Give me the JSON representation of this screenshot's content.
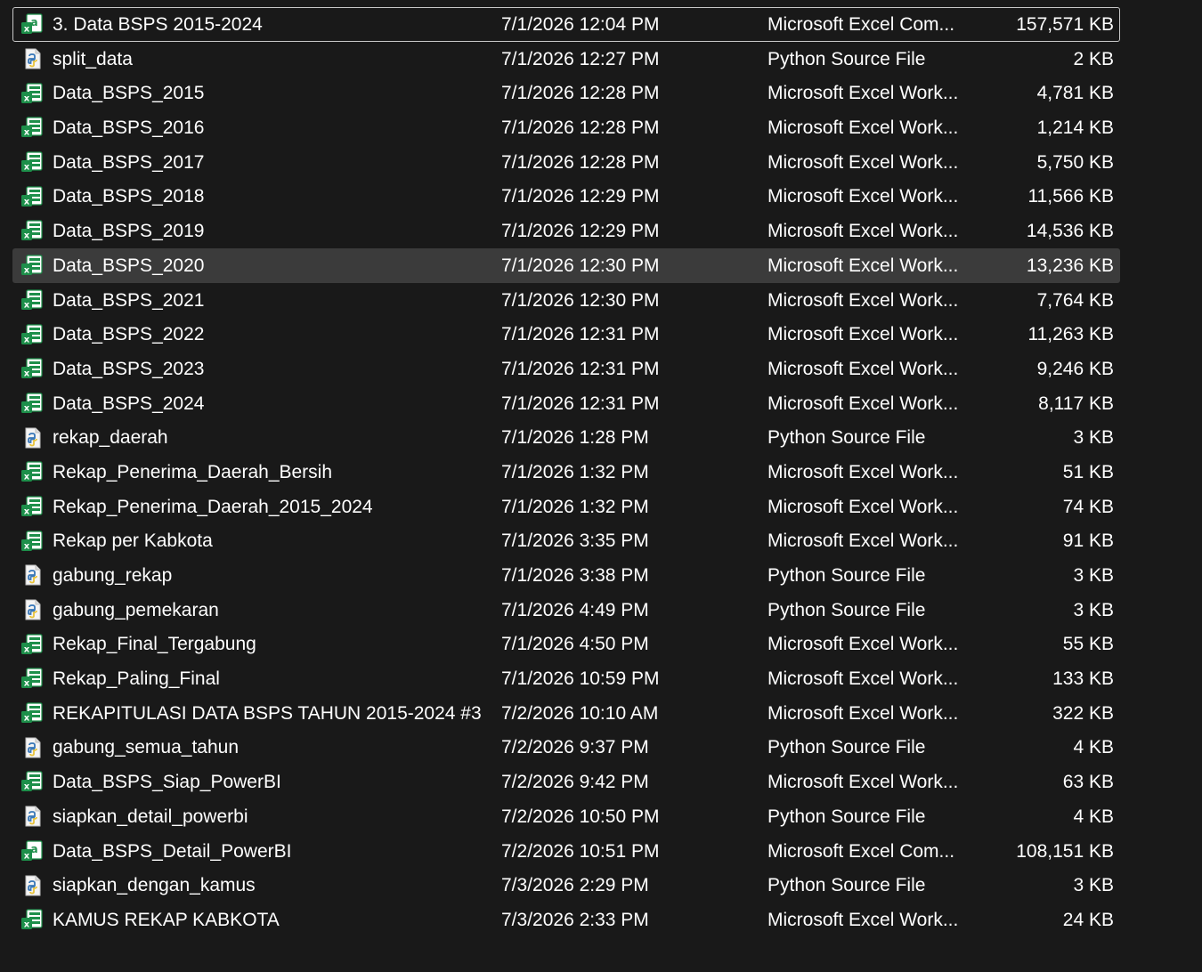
{
  "colors": {
    "background": "#191919",
    "text": "#ffffff",
    "selected_row": "#3b3b3b",
    "focus_border": "#c8c8c8",
    "excel_green": "#1d8f4a",
    "python_blue": "#3a78b8"
  },
  "files": [
    {
      "name": "3. Data BSPS 2015-2024",
      "date": "7/1/2026 12:04 PM",
      "type": "Microsoft Excel Com...",
      "size": "157,571 KB",
      "icon": "excel-csv-icon",
      "state": "focused"
    },
    {
      "name": "split_data",
      "date": "7/1/2026 12:27 PM",
      "type": "Python Source File",
      "size": "2 KB",
      "icon": "python-file-icon",
      "state": ""
    },
    {
      "name": "Data_BSPS_2015",
      "date": "7/1/2026 12:28 PM",
      "type": "Microsoft Excel Work...",
      "size": "4,781 KB",
      "icon": "excel-workbook-icon",
      "state": ""
    },
    {
      "name": "Data_BSPS_2016",
      "date": "7/1/2026 12:28 PM",
      "type": "Microsoft Excel Work...",
      "size": "1,214 KB",
      "icon": "excel-workbook-icon",
      "state": ""
    },
    {
      "name": "Data_BSPS_2017",
      "date": "7/1/2026 12:28 PM",
      "type": "Microsoft Excel Work...",
      "size": "5,750 KB",
      "icon": "excel-workbook-icon",
      "state": ""
    },
    {
      "name": "Data_BSPS_2018",
      "date": "7/1/2026 12:29 PM",
      "type": "Microsoft Excel Work...",
      "size": "11,566 KB",
      "icon": "excel-workbook-icon",
      "state": ""
    },
    {
      "name": "Data_BSPS_2019",
      "date": "7/1/2026 12:29 PM",
      "type": "Microsoft Excel Work...",
      "size": "14,536 KB",
      "icon": "excel-workbook-icon",
      "state": ""
    },
    {
      "name": "Data_BSPS_2020",
      "date": "7/1/2026 12:30 PM",
      "type": "Microsoft Excel Work...",
      "size": "13,236 KB",
      "icon": "excel-workbook-icon",
      "state": "selected"
    },
    {
      "name": "Data_BSPS_2021",
      "date": "7/1/2026 12:30 PM",
      "type": "Microsoft Excel Work...",
      "size": "7,764 KB",
      "icon": "excel-workbook-icon",
      "state": ""
    },
    {
      "name": "Data_BSPS_2022",
      "date": "7/1/2026 12:31 PM",
      "type": "Microsoft Excel Work...",
      "size": "11,263 KB",
      "icon": "excel-workbook-icon",
      "state": ""
    },
    {
      "name": "Data_BSPS_2023",
      "date": "7/1/2026 12:31 PM",
      "type": "Microsoft Excel Work...",
      "size": "9,246 KB",
      "icon": "excel-workbook-icon",
      "state": ""
    },
    {
      "name": "Data_BSPS_2024",
      "date": "7/1/2026 12:31 PM",
      "type": "Microsoft Excel Work...",
      "size": "8,117 KB",
      "icon": "excel-workbook-icon",
      "state": ""
    },
    {
      "name": "rekap_daerah",
      "date": "7/1/2026 1:28 PM",
      "type": "Python Source File",
      "size": "3 KB",
      "icon": "python-file-icon",
      "state": ""
    },
    {
      "name": "Rekap_Penerima_Daerah_Bersih",
      "date": "7/1/2026 1:32 PM",
      "type": "Microsoft Excel Work...",
      "size": "51 KB",
      "icon": "excel-workbook-icon",
      "state": ""
    },
    {
      "name": "Rekap_Penerima_Daerah_2015_2024",
      "date": "7/1/2026 1:32 PM",
      "type": "Microsoft Excel Work...",
      "size": "74 KB",
      "icon": "excel-workbook-icon",
      "state": ""
    },
    {
      "name": "Rekap per Kabkota",
      "date": "7/1/2026 3:35 PM",
      "type": "Microsoft Excel Work...",
      "size": "91 KB",
      "icon": "excel-workbook-icon",
      "state": ""
    },
    {
      "name": "gabung_rekap",
      "date": "7/1/2026 3:38 PM",
      "type": "Python Source File",
      "size": "3 KB",
      "icon": "python-file-icon",
      "state": ""
    },
    {
      "name": "gabung_pemekaran",
      "date": "7/1/2026 4:49 PM",
      "type": "Python Source File",
      "size": "3 KB",
      "icon": "python-file-icon",
      "state": ""
    },
    {
      "name": "Rekap_Final_Tergabung",
      "date": "7/1/2026 4:50 PM",
      "type": "Microsoft Excel Work...",
      "size": "55 KB",
      "icon": "excel-workbook-icon",
      "state": ""
    },
    {
      "name": "Rekap_Paling_Final",
      "date": "7/1/2026 10:59 PM",
      "type": "Microsoft Excel Work...",
      "size": "133 KB",
      "icon": "excel-workbook-icon",
      "state": ""
    },
    {
      "name": "REKAPITULASI DATA BSPS TAHUN 2015-2024 #3",
      "date": "7/2/2026 10:10 AM",
      "type": "Microsoft Excel Work...",
      "size": "322 KB",
      "icon": "excel-workbook-icon",
      "state": ""
    },
    {
      "name": "gabung_semua_tahun",
      "date": "7/2/2026 9:37 PM",
      "type": "Python Source File",
      "size": "4 KB",
      "icon": "python-file-icon",
      "state": ""
    },
    {
      "name": "Data_BSPS_Siap_PowerBI",
      "date": "7/2/2026 9:42 PM",
      "type": "Microsoft Excel Work...",
      "size": "63 KB",
      "icon": "excel-workbook-icon",
      "state": ""
    },
    {
      "name": "siapkan_detail_powerbi",
      "date": "7/2/2026 10:50 PM",
      "type": "Python Source File",
      "size": "4 KB",
      "icon": "python-file-icon",
      "state": ""
    },
    {
      "name": "Data_BSPS_Detail_PowerBI",
      "date": "7/2/2026 10:51 PM",
      "type": "Microsoft Excel Com...",
      "size": "108,151 KB",
      "icon": "excel-csv-icon",
      "state": ""
    },
    {
      "name": "siapkan_dengan_kamus",
      "date": "7/3/2026 2:29 PM",
      "type": "Python Source File",
      "size": "3 KB",
      "icon": "python-file-icon",
      "state": ""
    },
    {
      "name": "KAMUS REKAP KABKOTA",
      "date": "7/3/2026 2:33 PM",
      "type": "Microsoft Excel Work...",
      "size": "24 KB",
      "icon": "excel-workbook-icon",
      "state": ""
    }
  ]
}
